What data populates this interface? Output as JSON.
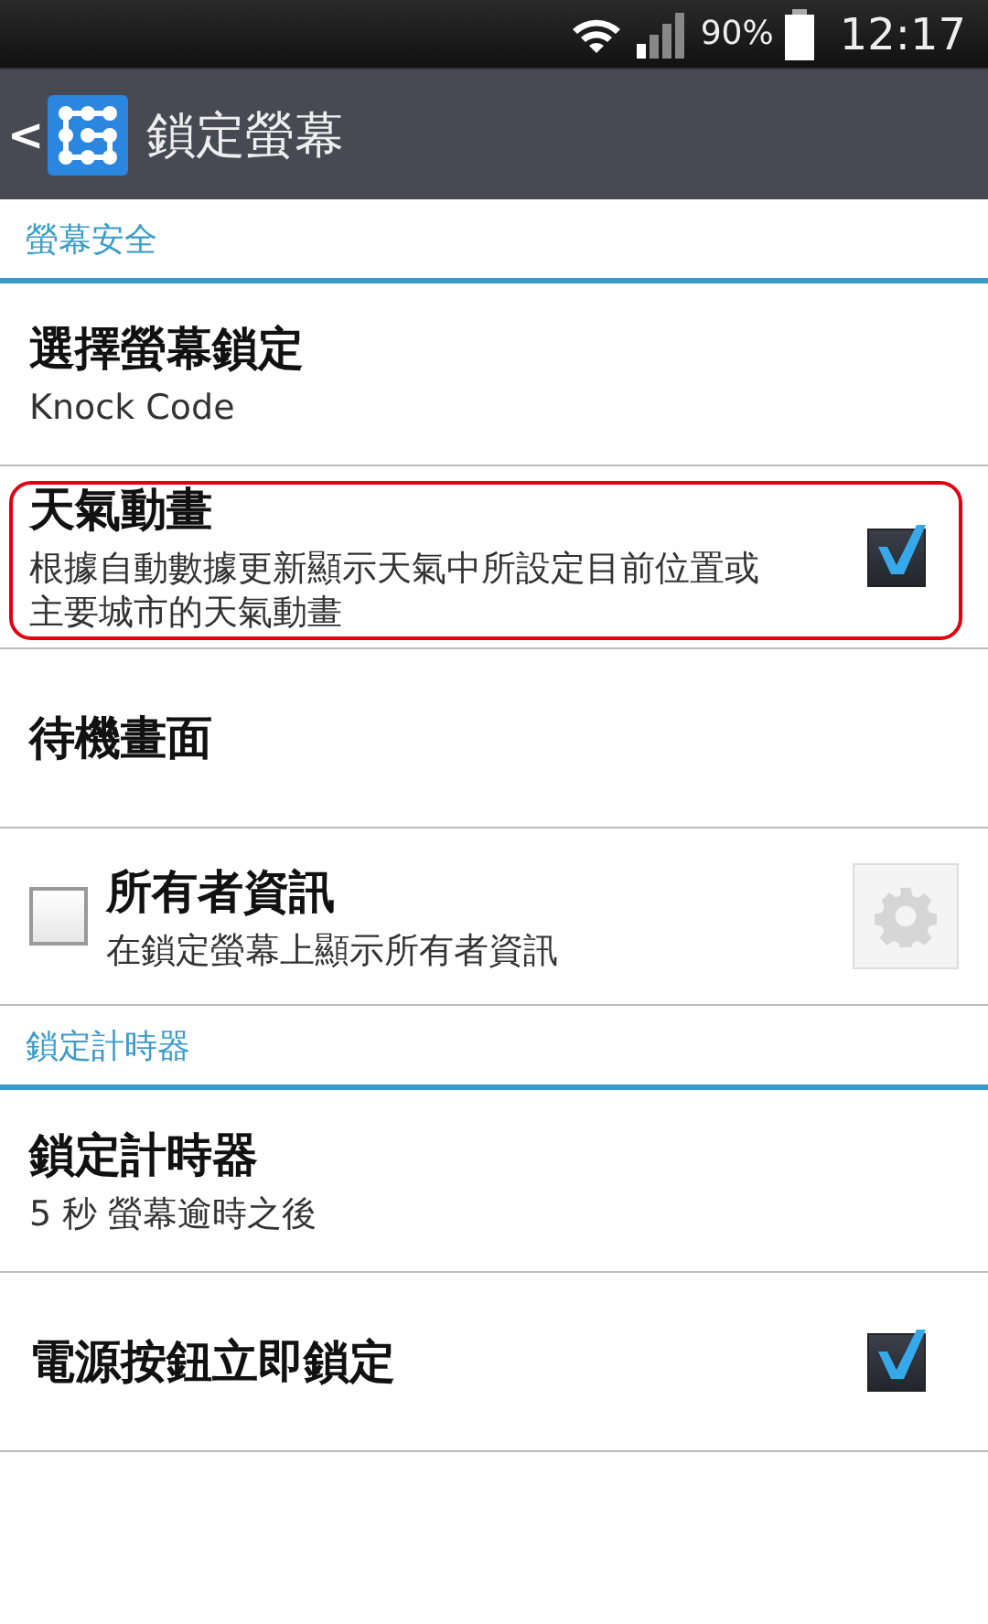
{
  "status_bar": {
    "battery_text": "90%",
    "time": "12:17"
  },
  "app_bar": {
    "back": "<",
    "title": "鎖定螢幕"
  },
  "sections": [
    {
      "header": "螢幕安全",
      "items": [
        {
          "kind": "plain",
          "title": "選擇螢幕鎖定",
          "summary": "Knock Code",
          "highlighted": false
        },
        {
          "kind": "check",
          "title": "天氣動畫",
          "summary": "根據自動數據更新顯示天氣中所設定目前位置或主要城市的天氣動畫",
          "checked": true,
          "highlighted": true
        },
        {
          "kind": "plain",
          "title": "待機畫面",
          "highlighted": false
        },
        {
          "kind": "owner",
          "title": "所有者資訊",
          "summary": "在鎖定螢幕上顯示所有者資訊",
          "checked": false,
          "highlighted": false
        }
      ]
    },
    {
      "header": "鎖定計時器",
      "items": [
        {
          "kind": "plain",
          "title": "鎖定計時器",
          "summary": "5 秒 螢幕逾時之後",
          "highlighted": false
        },
        {
          "kind": "check",
          "title": "電源按鈕立即鎖定",
          "checked": true,
          "highlighted": false
        }
      ]
    }
  ]
}
